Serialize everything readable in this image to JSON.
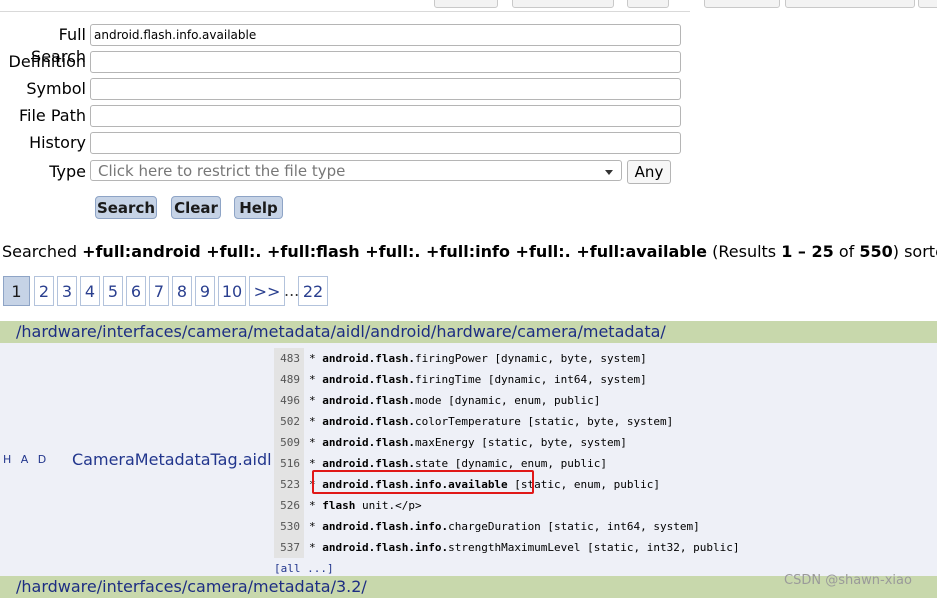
{
  "form": {
    "full_search_label": "Full Search",
    "full_search_value": "android.flash.info.available",
    "definition_label": "Definition",
    "symbol_label": "Symbol",
    "file_path_label": "File Path",
    "history_label": "History",
    "type_label": "Type",
    "type_placeholder": "Click here to restrict the file type",
    "any_label": "Any",
    "search_label": "Search",
    "clear_label": "Clear",
    "help_label": "Help"
  },
  "summary": {
    "prefix": "Searched ",
    "query": "+full:android +full:. +full:flash +full:. +full:info +full:. +full:available",
    "results_pre": " (Results ",
    "range": "1 – 25",
    "of": " of ",
    "total": "550",
    "suffix": ") sorted by relevance"
  },
  "pager": {
    "pages": [
      "1",
      "2",
      "3",
      "4",
      "5",
      "6",
      "7",
      "8",
      "9",
      "10",
      ">>",
      "...",
      "22"
    ],
    "current": "1"
  },
  "results": [
    {
      "dir": "/hardware/interfaces/camera/metadata/aidl/android/hardware/camera/metadata/",
      "tags": "H A D",
      "file": "CameraMetadataTag.aidl",
      "lines": [
        {
          "num": "483",
          "pre": "* ",
          "bold": "android.flash.",
          "rest": "firingPower [dynamic, byte, system]"
        },
        {
          "num": "489",
          "pre": "* ",
          "bold": "android.flash.",
          "rest": "firingTime [dynamic, int64, system]"
        },
        {
          "num": "496",
          "pre": "* ",
          "bold": "android.flash.",
          "rest": "mode [dynamic, enum, public]"
        },
        {
          "num": "502",
          "pre": "* ",
          "bold": "android.flash.",
          "rest": "colorTemperature [static, byte, system]"
        },
        {
          "num": "509",
          "pre": "* ",
          "bold": "android.flash.",
          "rest": "maxEnergy [static, byte, system]"
        },
        {
          "num": "516",
          "pre": "* ",
          "bold": "android.flash.",
          "rest": "state [dynamic, enum, public]"
        },
        {
          "num": "523",
          "pre": "* ",
          "bold": "android.flash.info.available",
          "rest": " [static, enum, public]"
        },
        {
          "num": "526",
          "pre": "* ",
          "bold": "flash",
          "rest": " unit.</p>"
        },
        {
          "num": "530",
          "pre": "* ",
          "bold": "android.flash.info.",
          "rest": "chargeDuration [static, int64, system]"
        },
        {
          "num": "537",
          "pre": "* ",
          "bold": "android.flash.info.",
          "rest": "strengthMaximumLevel [static, int32, public]"
        }
      ],
      "more": "[all ...]"
    },
    {
      "dir": "/hardware/interfaces/camera/metadata/3.2/"
    }
  ],
  "watermark": "CSDN @shawn-xiao",
  "colors": {
    "dir_bar": "#c8d8ac",
    "result_bg": "#eef0f7",
    "link": "#22368d",
    "button": "#c6d3e6",
    "highlight": "#e01818"
  }
}
